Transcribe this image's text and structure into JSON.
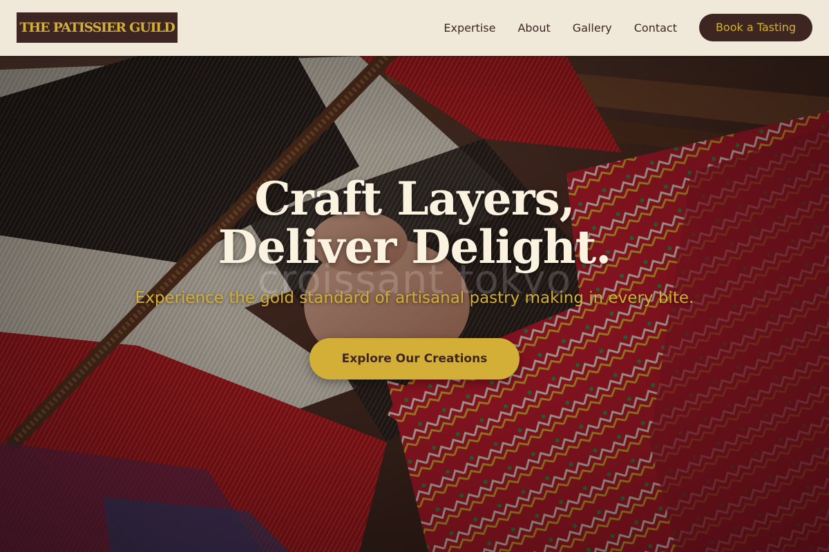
{
  "brand": {
    "name": "THE PATISSIER GUILD",
    "colors": {
      "dark_brown": "#3d2622",
      "gold": "#d4af37",
      "cream": "#f0e8d8"
    }
  },
  "nav": {
    "links": [
      "Expertise",
      "About",
      "Gallery",
      "Contact"
    ],
    "cta_label": "Book a Tasting"
  },
  "hero": {
    "title_line1": "Craft Layers,",
    "title_line2": "Deliver Delight.",
    "watermark": "croissant tokyo",
    "subtitle": "Experience the gold standard of artisanal pastry making in every bite.",
    "button_label": "Explore Our Creations"
  }
}
